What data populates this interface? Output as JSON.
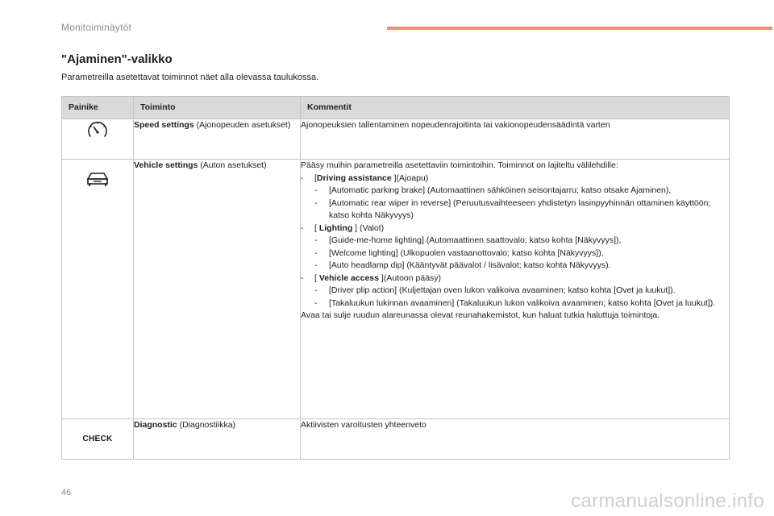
{
  "header": {
    "title": "Monitoiminäytöt",
    "accent_color": "#f28f6b"
  },
  "section": {
    "title": "\"Ajaminen\"-valikko",
    "intro": "Parametreilla asetettavat toiminnot näet alla olevassa taulukossa."
  },
  "table": {
    "headers": [
      "Painike",
      "Toiminto",
      "Kommentit"
    ],
    "rows": [
      {
        "icon": "speedometer-icon",
        "function_bold": "Speed settings",
        "function_rest": " (Ajonopeuden asetukset)",
        "comment": "Ajonopeuksien tallentaminen nopeudenrajoitinta tai vakionopeudensäädintä varten"
      },
      {
        "icon": "car-icon",
        "function_bold": "Vehicle settings",
        "function_rest": " (Auton asetukset)",
        "comment_intro": "Pääsy muihin parametreilla asetettaviin toimintoihin. Toiminnot on lajiteltu välilehdille:",
        "tabs": [
          {
            "prefix": "[",
            "name": "Driving assistance",
            "suffix": " ](Ajoapu)",
            "items": [
              "[Automatic parking brake] (Automaattinen sähköinen seisontajarru; katso otsake Ajaminen),",
              "[Automatic rear wiper in reverse] (Peruutusvaihteeseen yhdistetyn lasinpyyhinnän ottaminen käyttöön; katso kohta Näkyvyys)"
            ]
          },
          {
            "prefix": "[ ",
            "name": "Lighting",
            "suffix": " ] (Valot)",
            "items": [
              "[Guide-me-home lighting] (Automaattinen saattovalo; katso kohta [Näkyvyys]),",
              "[Welcome lighting] (Ulkopuolen vastaanottovalo; katso kohta [Näkyvyys]),",
              "[Auto headlamp dip] (Kääntyvät päävalot / lisävalot; katso kohta Näkyvyys)."
            ]
          },
          {
            "prefix": "[ ",
            "name": "Vehicle access",
            "suffix": " ](Autoon pääsy)",
            "items": [
              "[Driver plip action] (Kuljettajan oven lukon valikoiva avaaminen; katso kohta [Ovet ja luukut]).",
              "[Takaluukun lukinnan avaaminen] (Takaluukun lukon valikoiva avaaminen; katso kohta [Ovet ja luukut])."
            ]
          }
        ],
        "comment_outro": "Avaa tai sulje ruudun alareunassa olevat reunahakemistot, kun haluat tutkia haluttuja toimintoja."
      },
      {
        "icon_label": "CHECK",
        "function_bold": "Diagnostic",
        "function_rest": " (Diagnostiikka)",
        "comment": "Aktiivisten varoitusten yhteenveto"
      }
    ]
  },
  "footer": {
    "page_number": "46",
    "watermark": "carmanualsonline.info"
  }
}
